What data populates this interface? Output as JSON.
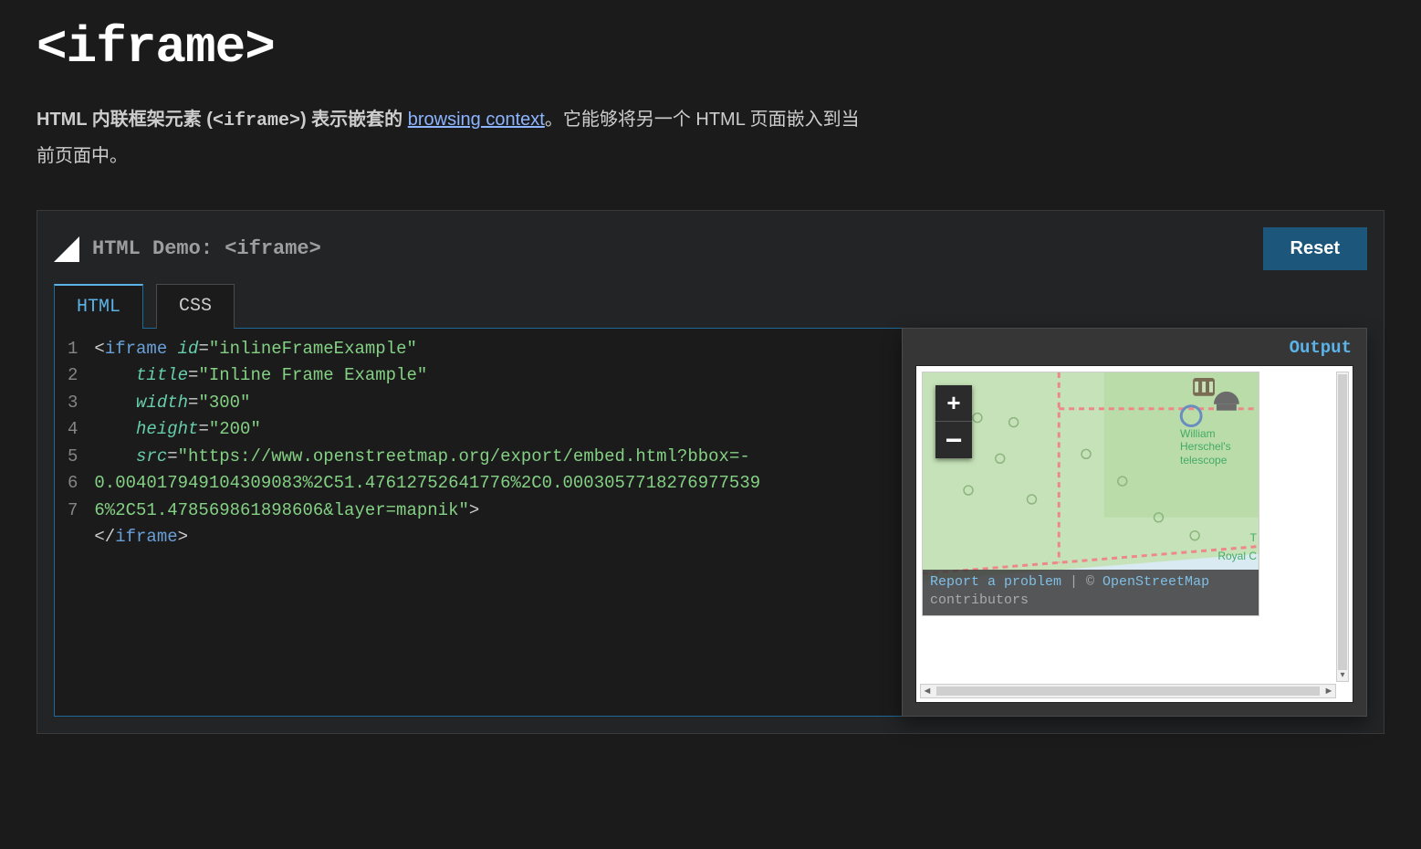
{
  "page": {
    "title": "<iframe>",
    "intro_prefix": "HTML 内联框架元素 (",
    "intro_code": "<iframe>",
    "intro_mid": ") 表示嵌套的 ",
    "intro_link": "browsing context",
    "intro_suffix": "。它能够将另一个 HTML 页面嵌入到当前页面中。"
  },
  "demo": {
    "title": "HTML Demo: <iframe>",
    "reset_label": "Reset",
    "tabs": {
      "html": "HTML",
      "css": "CSS"
    },
    "output_label": "Output"
  },
  "code": {
    "line_numbers": [
      "1",
      "2",
      "3",
      "4",
      "5",
      "6",
      "7"
    ],
    "l1_open": "<",
    "l1_tag": "iframe",
    "l1_attr": " id",
    "l1_eq": "=",
    "l1_val": "\"inlineFrameExample\"",
    "l2_attr": "title",
    "l2_val": "\"Inline Frame Example\"",
    "l3_attr": "width",
    "l3_val": "\"300\"",
    "l4_attr": "height",
    "l4_val": "\"200\"",
    "l5_attr": "src",
    "l5_val": "\"https://www.openstreetmap.org/export/embed.html?bbox=-0.004017949104309083%2C51.47612752641776%2C0.00030577182769775396%2C51.478569861898606&layer=mapnik\"",
    "l5_close": ">",
    "l6_open": "</",
    "l6_tag": "iframe",
    "l6_close": ">"
  },
  "map": {
    "zoom_in": "+",
    "zoom_out": "−",
    "poi1": "William Herschel's telescope",
    "poi2": "T",
    "poi3": "Royal C",
    "report_link": "Report a problem",
    "sep": " | © ",
    "osm_link": "OpenStreetMap",
    "contrib": " contributors",
    "scroll_left": "◄",
    "scroll_right": "►",
    "scroll_down": "▾"
  }
}
